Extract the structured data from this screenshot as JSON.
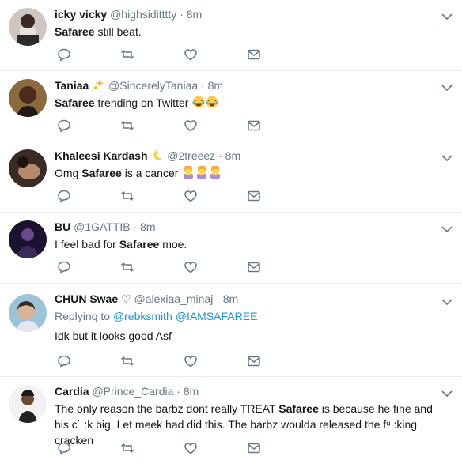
{
  "tweets": [
    {
      "name": "icky vicky",
      "handle": "@highsiditttty",
      "dot": "·",
      "time": "8m",
      "text_bold": "Safaree",
      "text_rest": " still beat."
    },
    {
      "name": "Taniaa",
      "name_emoji": "sparkle",
      "handle": "@SincerelyTaniaa",
      "dot": "·",
      "time": "8m",
      "text_bold": "Safaree",
      "text_rest": " trending on Twitter ",
      "emojis": "laughing-crying-x2"
    },
    {
      "name": "Khaleesi Kardash",
      "name_emoji": "crescent-moon",
      "handle": "@2treeez",
      "dot": "·",
      "time": "8m",
      "text_pre": "Omg ",
      "text_bold": "Safaree",
      "text_rest": " is a cancer ",
      "emojis": "facepalm-x3"
    },
    {
      "name": "BU",
      "handle": "@1GATTIB",
      "dot": "·",
      "time": "8m",
      "text_pre": "I feel bad for ",
      "text_bold": "Safaree",
      "text_rest": " moe."
    },
    {
      "name": "CHUN Swae",
      "name_suffix": "♡",
      "handle": "@alexiaa_minaj",
      "dot": "·",
      "time": "8m",
      "replying_label": "Replying to ",
      "replying_1": "@rebksmith",
      "replying_2": "@IAMSAFAREE",
      "text_plain": "Idk but it looks good Asf"
    },
    {
      "name": "Cardia",
      "handle": "@Prince_Cardia",
      "dot": "·",
      "time": "8m",
      "text_pre": "The only reason the barbz dont really TREAT ",
      "text_bold": "Safaree",
      "text_rest": " is because he fine and his c˙ :k big. Let meek had did this. The barbz woulda released the fᵘ :king cracken"
    }
  ],
  "colors": {
    "accent": "#1b95e0",
    "icon": "#657786",
    "divider": "#e6ecf0"
  }
}
